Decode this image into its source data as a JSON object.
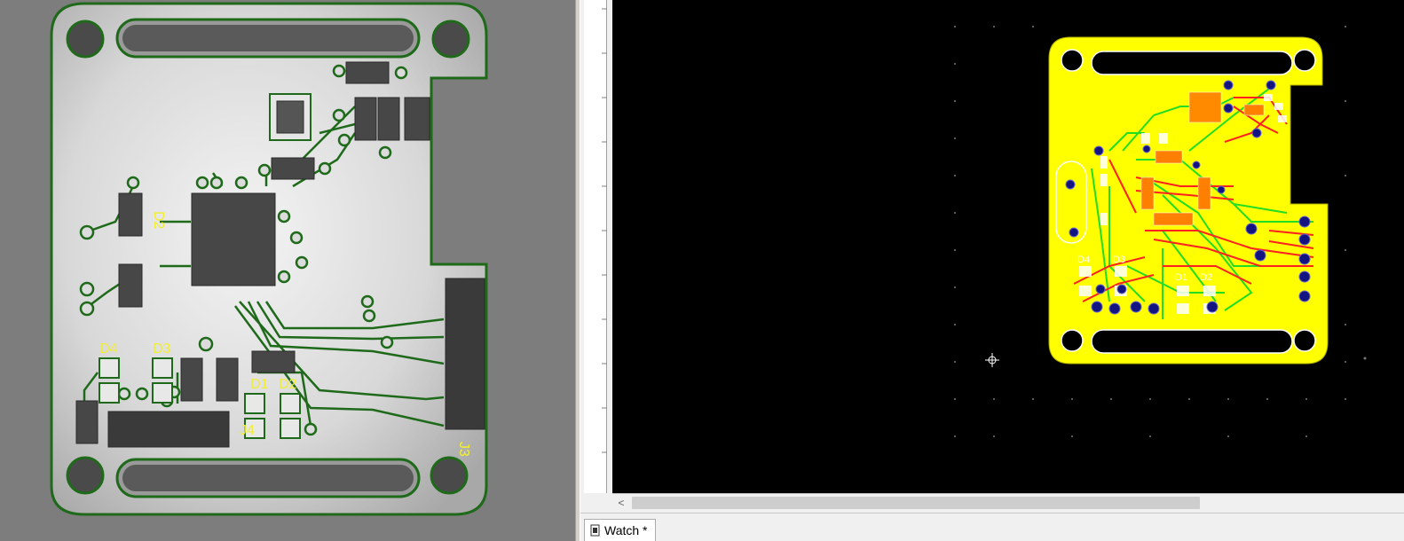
{
  "left_view": {
    "silkscreen_labels": [
      "D4",
      "D3",
      "D2",
      "D1",
      "D2",
      "J4",
      "J3"
    ]
  },
  "right_view": {
    "silkscreen_labels": [
      "D4",
      "D3",
      "D2",
      "D1"
    ]
  },
  "bottom_tab": {
    "label": "Watch *",
    "icon": "watch-document-icon"
  },
  "scrollbar": {
    "left_arrow": "<"
  },
  "colors": {
    "render_background": "#7d7d7d",
    "board_edge": "#1f6a1a",
    "silkscreen": "#f2ee30",
    "canvas_background": "#000000",
    "copper_fill": "#ffff00",
    "top_trace": "#ff2020",
    "bottom_trace": "#22dd22",
    "via": "#141480"
  }
}
